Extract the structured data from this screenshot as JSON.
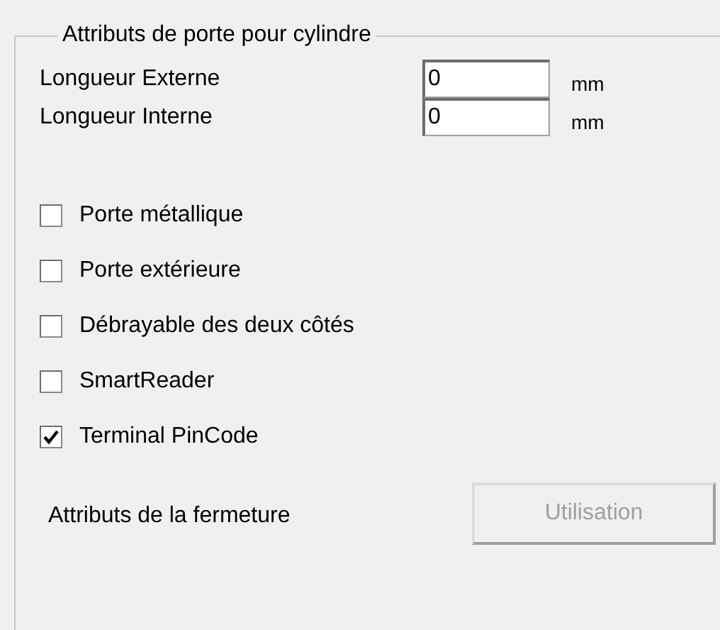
{
  "group": {
    "title": "Attributs de porte pour cylindre"
  },
  "lengths": [
    {
      "label": "Longueur Externe",
      "value": "0",
      "unit": "mm"
    },
    {
      "label": "Longueur Interne",
      "value": "0",
      "unit": "mm"
    }
  ],
  "options": [
    {
      "label": "Porte métallique",
      "checked": false
    },
    {
      "label": "Porte extérieure",
      "checked": false
    },
    {
      "label": "Débrayable des deux côtés",
      "checked": false
    },
    {
      "label": "SmartReader",
      "checked": false
    },
    {
      "label": "Terminal PinCode",
      "checked": true
    }
  ],
  "closure": {
    "label": "Attributs de la fermeture",
    "button": {
      "label": "Utilisation",
      "disabled": true
    }
  }
}
